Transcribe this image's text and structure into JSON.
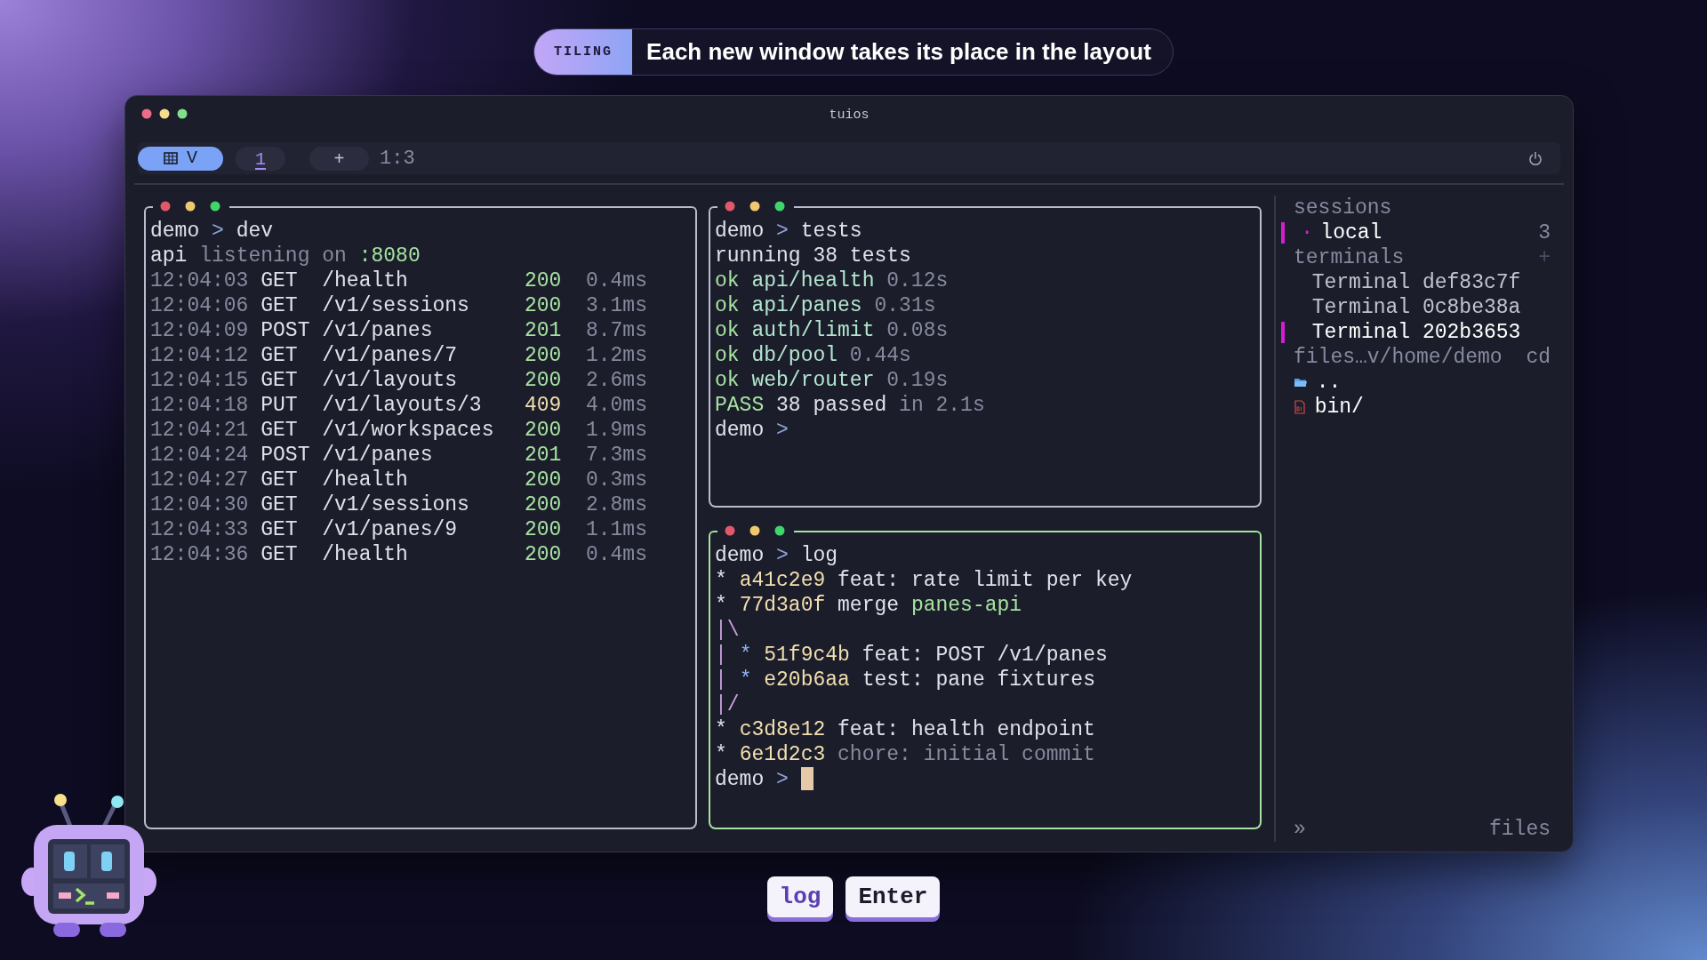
{
  "banner": {
    "tag": "TILING",
    "text": "Each new window takes its place in the layout"
  },
  "window": {
    "title": "tuios"
  },
  "toolbar": {
    "layout_label": "V",
    "tabs": [
      {
        "label": "1",
        "selected": true
      }
    ],
    "add_label": "+",
    "position": "1:3"
  },
  "panes": [
    {
      "focused": false,
      "lines": [
        {
          "kind": "text",
          "segments": [
            {
              "text": "demo",
              "color": "#e0e2ea"
            },
            {
              "text": ">",
              "color": "#8ea4d6"
            },
            {
              "text": "dev",
              "color": "#e0e2ea"
            }
          ]
        },
        {
          "kind": "text",
          "segments": [
            {
              "text": "api",
              "color": "#e0e2ea"
            },
            {
              "text": "listening on",
              "color": "#868a9e"
            },
            {
              "text": ":8080",
              "color": "#a6e3a1"
            }
          ]
        },
        {
          "kind": "request",
          "time": "12:04:03",
          "method": "GET",
          "path": "/health",
          "status": {
            "text": "200",
            "color": "#a6e3a1"
          },
          "duration": "0.4ms"
        },
        {
          "kind": "request",
          "time": "12:04:06",
          "method": "GET",
          "path": "/v1/sessions",
          "status": {
            "text": "200",
            "color": "#a6e3a1"
          },
          "duration": "3.1ms"
        },
        {
          "kind": "request",
          "time": "12:04:09",
          "method": "POST",
          "path": "/v1/panes",
          "status": {
            "text": "201",
            "color": "#a6e3a1"
          },
          "duration": "8.7ms"
        },
        {
          "kind": "request",
          "time": "12:04:12",
          "method": "GET",
          "path": "/v1/panes/7",
          "status": {
            "text": "200",
            "color": "#a6e3a1"
          },
          "duration": "1.2ms"
        },
        {
          "kind": "request",
          "time": "12:04:15",
          "method": "GET",
          "path": "/v1/layouts",
          "status": {
            "text": "200",
            "color": "#a6e3a1"
          },
          "duration": "2.6ms"
        },
        {
          "kind": "request",
          "time": "12:04:18",
          "method": "PUT",
          "path": "/v1/layouts/3",
          "status": {
            "text": "409",
            "color": "#f2dfb0"
          },
          "duration": "4.0ms"
        },
        {
          "kind": "request",
          "time": "12:04:21",
          "method": "GET",
          "path": "/v1/workspaces",
          "status": {
            "text": "200",
            "color": "#a6e3a1"
          },
          "duration": "1.9ms"
        },
        {
          "kind": "request",
          "time": "12:04:24",
          "method": "POST",
          "path": "/v1/panes",
          "status": {
            "text": "201",
            "color": "#a6e3a1"
          },
          "duration": "7.3ms"
        },
        {
          "kind": "request",
          "time": "12:04:27",
          "method": "GET",
          "path": "/health",
          "status": {
            "text": "200",
            "color": "#a6e3a1"
          },
          "duration": "0.3ms"
        },
        {
          "kind": "request",
          "time": "12:04:30",
          "method": "GET",
          "path": "/v1/sessions",
          "status": {
            "text": "200",
            "color": "#a6e3a1"
          },
          "duration": "2.8ms"
        },
        {
          "kind": "request",
          "time": "12:04:33",
          "method": "GET",
          "path": "/v1/panes/9",
          "status": {
            "text": "200",
            "color": "#a6e3a1"
          },
          "duration": "1.1ms"
        },
        {
          "kind": "request",
          "time": "12:04:36",
          "method": "GET",
          "path": "/health",
          "status": {
            "text": "200",
            "color": "#a6e3a1"
          },
          "duration": "0.4ms"
        }
      ]
    },
    {
      "focused": false,
      "lines": [
        {
          "kind": "text",
          "segments": [
            {
              "text": "demo",
              "color": "#e0e2ea"
            },
            {
              "text": ">",
              "color": "#8ea4d6"
            },
            {
              "text": "tests",
              "color": "#e0e2ea"
            }
          ]
        },
        {
          "kind": "text",
          "segments": [
            {
              "text": "running 38 tests",
              "color": "#e0e2ea"
            }
          ]
        },
        {
          "kind": "text",
          "segments": [
            {
              "text": "ok",
              "color": "#a6e3a1"
            },
            {
              "text": "api/health",
              "color": "#b3e6cf"
            },
            {
              "text": "0.12s",
              "color": "#868a9e"
            }
          ]
        },
        {
          "kind": "text",
          "segments": [
            {
              "text": "ok",
              "color": "#a6e3a1"
            },
            {
              "text": "api/panes",
              "color": "#b3e6cf"
            },
            {
              "text": "0.31s",
              "color": "#868a9e"
            }
          ]
        },
        {
          "kind": "text",
          "segments": [
            {
              "text": "ok",
              "color": "#a6e3a1"
            },
            {
              "text": "auth/limit",
              "color": "#b3e6cf"
            },
            {
              "text": "0.08s",
              "color": "#868a9e"
            }
          ]
        },
        {
          "kind": "text",
          "segments": [
            {
              "text": "ok",
              "color": "#a6e3a1"
            },
            {
              "text": "db/pool",
              "color": "#b3e6cf"
            },
            {
              "text": "0.44s",
              "color": "#868a9e"
            }
          ]
        },
        {
          "kind": "text",
          "segments": [
            {
              "text": "ok",
              "color": "#a6e3a1"
            },
            {
              "text": "web/router",
              "color": "#b3e6cf"
            },
            {
              "text": "0.19s",
              "color": "#868a9e"
            }
          ]
        },
        {
          "kind": "text",
          "segments": [
            {
              "text": "PASS",
              "color": "#a6e3a1"
            },
            {
              "text": "38 passed",
              "color": "#e0e2ea"
            },
            {
              "text": "in 2.1s",
              "color": "#868a9e"
            }
          ]
        },
        {
          "kind": "text",
          "segments": [
            {
              "text": "demo",
              "color": "#e0e2ea"
            },
            {
              "text": ">",
              "color": "#8ea4d6"
            }
          ]
        }
      ]
    },
    {
      "focused": true,
      "lines": [
        {
          "kind": "text",
          "segments": [
            {
              "text": "demo",
              "color": "#e0e2ea"
            },
            {
              "text": ">",
              "color": "#8ea4d6"
            },
            {
              "text": "log",
              "color": "#e0e2ea"
            }
          ]
        },
        {
          "kind": "text",
          "segments": [
            {
              "text": "*",
              "color": "#e0e2ea"
            },
            {
              "text": "a41c2e9",
              "color": "#f2dfb0"
            },
            {
              "text": "feat: rate limit per key",
              "color": "#e0e2ea"
            }
          ]
        },
        {
          "kind": "text",
          "segments": [
            {
              "text": "*",
              "color": "#e0e2ea"
            },
            {
              "text": "77d3a0f",
              "color": "#f2dfb0"
            },
            {
              "text": "merge",
              "color": "#e0e2ea"
            },
            {
              "text": "panes-api",
              "color": "#a6e3a1"
            }
          ]
        },
        {
          "kind": "text",
          "segments": [
            {
              "text": "|\\",
              "color": "#c9a0dc"
            }
          ]
        },
        {
          "kind": "text",
          "segments": [
            {
              "text": "|",
              "color": "#c9a0dc"
            },
            {
              "text": "*",
              "color": "#8fb3f0"
            },
            {
              "text": "51f9c4b",
              "color": "#f2dfb0"
            },
            {
              "text": "feat: POST /v1/panes",
              "color": "#e0e2ea"
            }
          ]
        },
        {
          "kind": "text",
          "segments": [
            {
              "text": "|",
              "color": "#c9a0dc"
            },
            {
              "text": "*",
              "color": "#8fb3f0"
            },
            {
              "text": "e20b6aa",
              "color": "#f2dfb0"
            },
            {
              "text": "test: pane fixtures",
              "color": "#e0e2ea"
            }
          ]
        },
        {
          "kind": "text",
          "segments": [
            {
              "text": "|/",
              "color": "#c9a0dc"
            }
          ]
        },
        {
          "kind": "text",
          "segments": [
            {
              "text": "*",
              "color": "#e0e2ea"
            },
            {
              "text": "c3d8e12",
              "color": "#f2dfb0"
            },
            {
              "text": "feat: health endpoint",
              "color": "#e0e2ea"
            }
          ]
        },
        {
          "kind": "text",
          "segments": [
            {
              "text": "*",
              "color": "#e0e2ea"
            },
            {
              "text": "6e1d2c3",
              "color": "#f2dfb0"
            },
            {
              "text": "chore: initial commit",
              "color": "#868a9e"
            }
          ]
        },
        {
          "kind": "text",
          "cursor": true,
          "segments": [
            {
              "text": "demo",
              "color": "#e0e2ea"
            },
            {
              "text": ">",
              "color": "#8ea4d6"
            }
          ]
        }
      ]
    }
  ],
  "sidebar": {
    "sessions_heading": "sessions",
    "sessions": [
      {
        "marker": "·",
        "label": "local",
        "count": "3",
        "selected": true
      }
    ],
    "terminals_heading": "terminals",
    "terminals_action": "+",
    "terminals": [
      {
        "label": "Terminal def83c7f",
        "selected": false
      },
      {
        "label": "Terminal 0c8be38a",
        "selected": false
      },
      {
        "label": "Terminal 202b3653",
        "selected": true
      }
    ],
    "files_heading": "files",
    "files_path": "…v/home/demo",
    "files_action": "cd",
    "files": [
      {
        "kind": "folder",
        "name": ".."
      },
      {
        "kind": "binary",
        "name": "bin/"
      }
    ],
    "footer_toggle": "»",
    "footer_label": "files"
  },
  "keys": [
    {
      "label": "log",
      "kind": "typed"
    },
    {
      "label": "Enter",
      "kind": "key"
    }
  ]
}
